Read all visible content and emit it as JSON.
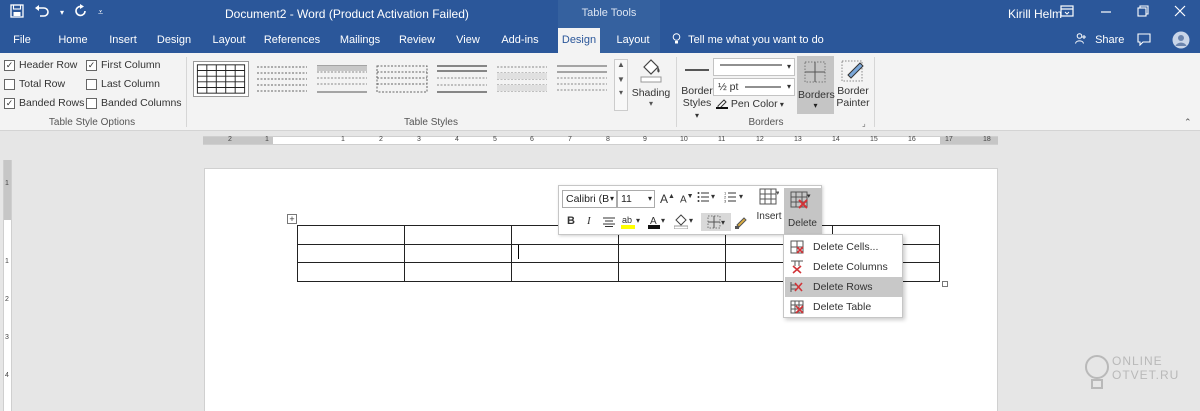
{
  "window": {
    "title": "Document2 - Word (Product Activation Failed)",
    "context_tab_group": "Table Tools",
    "user": "Kirill Helm"
  },
  "tabs": [
    "File",
    "Home",
    "Insert",
    "Design",
    "Layout",
    "References",
    "Mailings",
    "Review",
    "View",
    "Add-ins",
    "Design",
    "Layout"
  ],
  "active_tab_index": 10,
  "tell_me": "Tell me what you want to do",
  "share": "Share",
  "ribbon": {
    "table_style_options": {
      "label": "Table Style Options",
      "checkboxes": [
        {
          "label": "Header Row",
          "checked": true
        },
        {
          "label": "Total Row",
          "checked": false
        },
        {
          "label": "Banded Rows",
          "checked": true
        },
        {
          "label": "First Column",
          "checked": true
        },
        {
          "label": "Last Column",
          "checked": false
        },
        {
          "label": "Banded Columns",
          "checked": false
        }
      ]
    },
    "table_styles": {
      "label": "Table Styles",
      "shading": "Shading"
    },
    "borders": {
      "label": "Borders",
      "border_styles_line1": "Border",
      "border_styles_line2": "Styles",
      "line_weight": "½ pt",
      "pen_color": "Pen Color",
      "borders_btn": "Borders",
      "border_painter_line1": "Border",
      "border_painter_line2": "Painter"
    }
  },
  "ruler": {
    "h_numbers": [
      "2",
      "1",
      "1",
      "2",
      "3",
      "4",
      "5",
      "6",
      "7",
      "8",
      "9",
      "10",
      "11",
      "12",
      "13",
      "14",
      "15",
      "16",
      "17",
      "18"
    ],
    "v_numbers": [
      "1",
      "1",
      "2",
      "3",
      "4"
    ]
  },
  "mini_toolbar": {
    "font": "Calibri (B",
    "size": "11",
    "bold": "B",
    "italic": "I",
    "insert": "Insert",
    "delete": "Delete"
  },
  "delete_menu": {
    "items": [
      "Delete Cells...",
      "Delete Columns",
      "Delete Rows",
      "Delete Table"
    ],
    "highlighted_index": 2
  },
  "watermark": {
    "line1": "ONLINE",
    "line2": "OTVET.RU"
  },
  "colors": {
    "accent": "#2b579a",
    "ribbon_bg": "#f3f3f3",
    "highlight": "#c8c8c8"
  }
}
